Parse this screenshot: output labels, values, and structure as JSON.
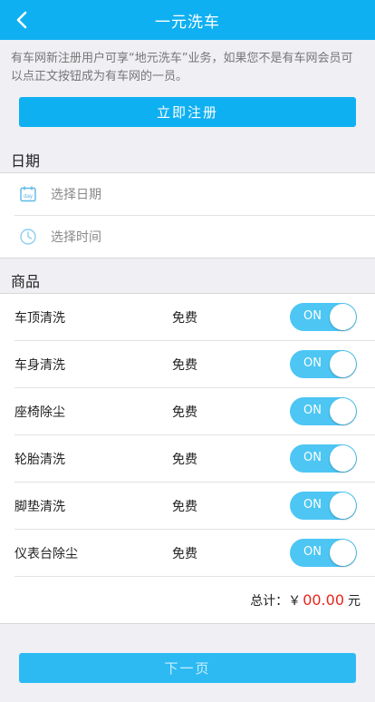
{
  "nav": {
    "title": "一元洗车",
    "back_icon": "chevron-left-icon"
  },
  "intro": "有车网新注册用户可享“地元洗车”业务，如果您不是有车网会员可以点正文按钮成为有车网的一员。",
  "register_label": "立即注册",
  "date_section": {
    "title": "日期",
    "date_placeholder": "选择日期",
    "time_placeholder": "选择时间",
    "date_icon": "calendar-icon",
    "date_icon_text": "day",
    "time_icon": "clock-icon"
  },
  "goods_section": {
    "title": "商品",
    "items": [
      {
        "name": "车顶清洗",
        "price": "免费",
        "toggle": "ON"
      },
      {
        "name": "车身清洗",
        "price": "免费",
        "toggle": "ON"
      },
      {
        "name": "座椅除尘",
        "price": "免费",
        "toggle": "ON"
      },
      {
        "name": "轮胎清洗",
        "price": "免费",
        "toggle": "ON"
      },
      {
        "name": "脚垫清洗",
        "price": "免费",
        "toggle": "ON"
      },
      {
        "name": "仪表台除尘",
        "price": "免费",
        "toggle": "ON"
      }
    ],
    "total_label": "总计：￥",
    "total_amount": "00.00",
    "total_unit": "元"
  },
  "next_label": "下一页",
  "colors": {
    "accent": "#0fb0f2",
    "toggle_on": "#4dc6f4",
    "price_red": "#e8261c"
  }
}
